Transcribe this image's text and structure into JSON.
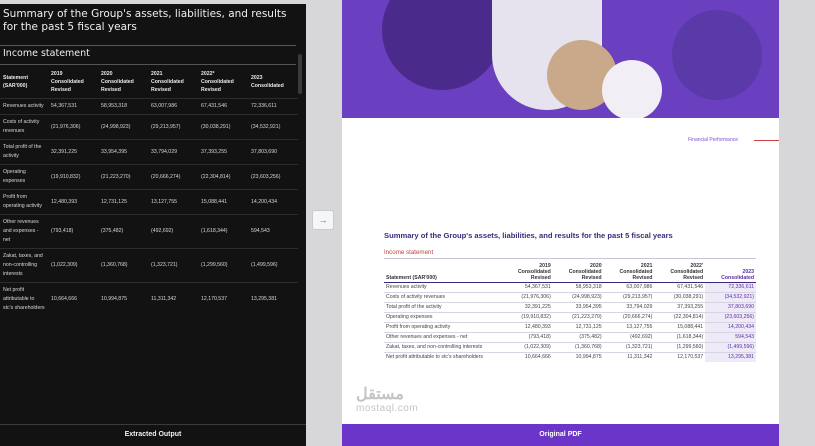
{
  "left": {
    "title": "Summary of the Group's assets, liabilities, and results for the past 5 fiscal years",
    "section": "Income statement",
    "footer": "Extracted Output",
    "columns": [
      {
        "l1": "Statement",
        "l2": "(SAR'000)",
        "l3": ""
      },
      {
        "l1": "2019",
        "l2": "Consolidated",
        "l3": "Revised"
      },
      {
        "l1": "2020",
        "l2": "Consolidated",
        "l3": "Revised"
      },
      {
        "l1": "2021",
        "l2": "Consolidated",
        "l3": "Revised"
      },
      {
        "l1": "2022*",
        "l2": "Consolidated",
        "l3": "Revised"
      },
      {
        "l1": "2023",
        "l2": "Consolidated",
        "l3": ""
      }
    ],
    "rows": [
      {
        "label": "Revenues activity",
        "v": [
          "54,367,531",
          "58,953,318",
          "63,007,986",
          "67,431,546",
          "72,336,611"
        ]
      },
      {
        "label": "Costs of activity revenues",
        "v": [
          "(21,976,306)",
          "(24,998,923)",
          "(29,213,957)",
          "(30,038,291)",
          "(34,532,921)"
        ]
      },
      {
        "label": "Total profit of the activity",
        "v": [
          "32,391,225",
          "33,954,395",
          "33,794,029",
          "37,393,255",
          "37,803,690"
        ]
      },
      {
        "label": "Operating expenses",
        "v": [
          "(19,910,832)",
          "(21,223,270)",
          "(20,666,274)",
          "(22,304,814)",
          "(23,603,256)"
        ]
      },
      {
        "label": "Profit from operating activity",
        "v": [
          "12,480,393",
          "12,731,125",
          "13,127,755",
          "15,088,441",
          "14,200,434"
        ]
      },
      {
        "label": "Other revenues and expenses - net",
        "v": [
          "(793,418)",
          "(375,482)",
          "(492,692)",
          "(1,618,344)",
          "594,543"
        ]
      },
      {
        "label": "Zakat, taxes, and non-controlling interests",
        "v": [
          "(1,022,309)",
          "(1,360,768)",
          "(1,323,721)",
          "(1,299,560)",
          "(1,499,596)"
        ]
      },
      {
        "label": "Net profit attributable to stc's shareholders",
        "v": [
          "10,664,666",
          "10,994,875",
          "11,311,342",
          "12,170,537",
          "13,295,381"
        ]
      }
    ]
  },
  "arrow": "→",
  "right": {
    "section_tag": "Financial Performance",
    "title": "Summary of the Group's assets, liabilities, and results for the past 5 fiscal years",
    "subtitle": "Income statement",
    "footer": "Original PDF",
    "watermark_ar": "مستقل",
    "watermark_en": "mostaql.com",
    "columns": [
      {
        "l1": "",
        "l2": "",
        "l3": "Statement (SAR'000)"
      },
      {
        "l1": "2019",
        "l2": "Consolidated",
        "l3": "Revised"
      },
      {
        "l1": "2020",
        "l2": "Consolidated",
        "l3": "Revised"
      },
      {
        "l1": "2021",
        "l2": "Consolidated",
        "l3": "Revised"
      },
      {
        "l1": "2022'",
        "l2": "Consolidated",
        "l3": "Revised"
      },
      {
        "l1": "2023",
        "l2": "",
        "l3": "Consolidated"
      }
    ],
    "rows": [
      {
        "label": "Revenues activity",
        "v": [
          "54,367,531",
          "58,953,318",
          "63,007,986",
          "67,431,546",
          "72,336,611"
        ]
      },
      {
        "label": "Costs of activity revenues",
        "v": [
          "(21,976,306)",
          "(24,998,923)",
          "(29,213,957)",
          "(30,038,291)",
          "(34,532,921)"
        ]
      },
      {
        "label": "Total profit of the activity",
        "v": [
          "32,391,225",
          "33,954,395",
          "33,794,029",
          "37,393,255",
          "37,803,690"
        ]
      },
      {
        "label": "Operating expenses",
        "v": [
          "(19,910,832)",
          "(21,223,270)",
          "(20,666,274)",
          "(22,304,814)",
          "(23,603,256)"
        ]
      },
      {
        "label": "Profit from operating activity",
        "v": [
          "12,480,393",
          "12,731,125",
          "13,127,755",
          "15,088,441",
          "14,200,434"
        ]
      },
      {
        "label": "Other revenues and expenses - net",
        "v": [
          "(793,418)",
          "(375,482)",
          "(492,692)",
          "(1,618,344)",
          "594,543"
        ]
      },
      {
        "label": "Zakat, taxes, and non-controlling interests",
        "v": [
          "(1,022,309)",
          "(1,360,768)",
          "(1,323,721)",
          "(1,299,560)",
          "(1,499,596)"
        ]
      },
      {
        "label": "Net profit attributable to stc's shareholders",
        "v": [
          "10,664,666",
          "10,994,875",
          "11,311,342",
          "12,170,537",
          "13,295,381"
        ]
      }
    ]
  }
}
